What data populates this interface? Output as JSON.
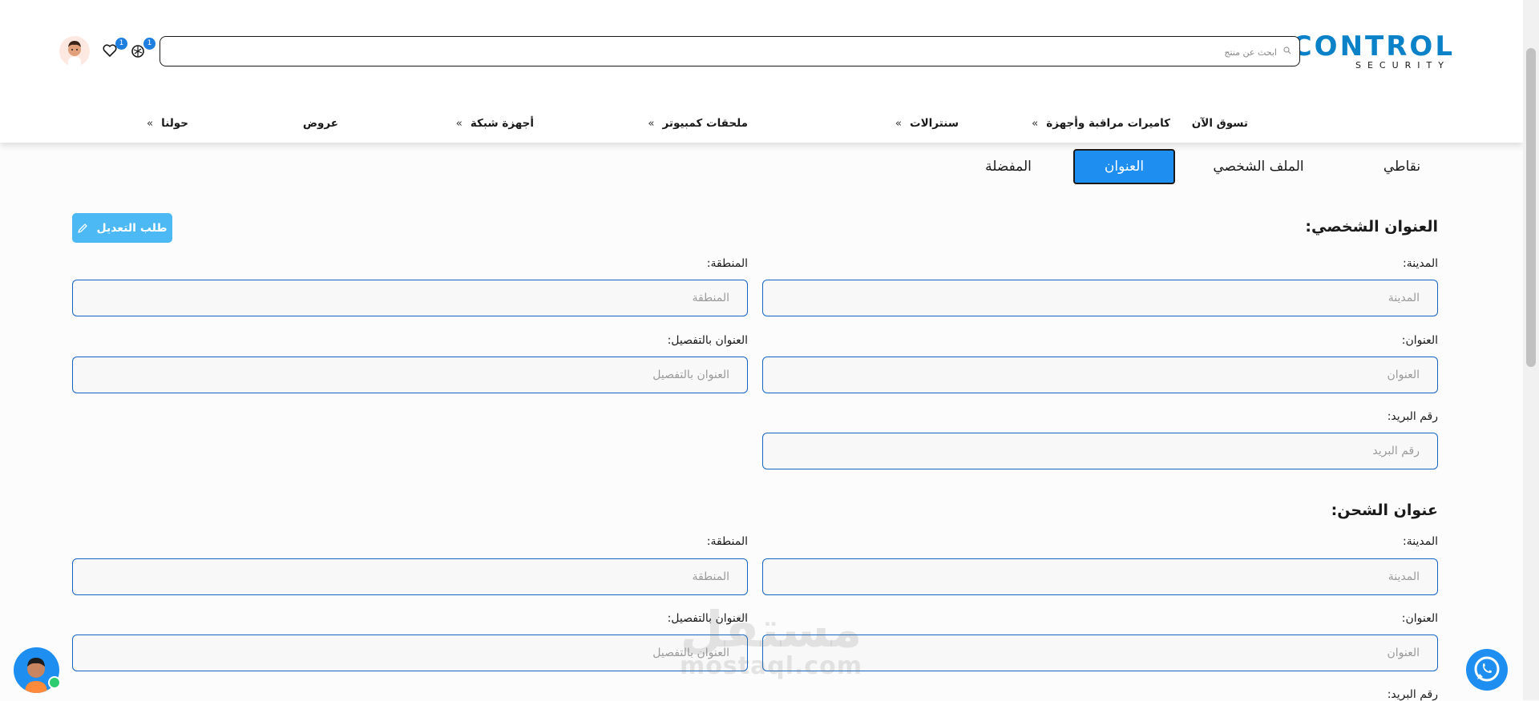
{
  "header": {
    "logo": {
      "main": "CONTROL",
      "sub": "SECURITY"
    },
    "search": {
      "placeholder": "ابحث عن منتج",
      "value": ""
    },
    "cart_count": "1",
    "wishlist_count": "1"
  },
  "nav": {
    "items": [
      {
        "label": "تسوق الآن",
        "chevron": ""
      },
      {
        "label": "كاميرات مراقبة وأجهزة",
        "chevron": "»"
      },
      {
        "label": "سنترالات",
        "chevron": "»"
      },
      {
        "label": "ملحقات كمبيوتر",
        "chevron": "»"
      },
      {
        "label": "أجهزة شبكة",
        "chevron": "»"
      },
      {
        "label": "عروض",
        "chevron": ""
      },
      {
        "label": "حولنا",
        "chevron": "»"
      }
    ]
  },
  "tabs": [
    {
      "label": "نقاطي",
      "active": false
    },
    {
      "label": "الملف الشخصي",
      "active": false
    },
    {
      "label": "العنوان",
      "active": true
    },
    {
      "label": "المفضلة",
      "active": false
    }
  ],
  "personal_address": {
    "title": "العنوان الشخصي:",
    "edit_button": "طلب التعديل",
    "city": {
      "label": "المدينة:",
      "placeholder": "المدينة",
      "value": ""
    },
    "region": {
      "label": "المنطقة:",
      "placeholder": "المنطقة",
      "value": ""
    },
    "address": {
      "label": "العنوان:",
      "placeholder": "العنوان",
      "value": ""
    },
    "detailed_address": {
      "label": "العنوان بالتفصيل:",
      "placeholder": "العنوان بالتفصيل",
      "value": ""
    },
    "postal_code": {
      "label": "رقم البريد:",
      "placeholder": "رقم البريد",
      "value": ""
    }
  },
  "shipping_address": {
    "title": "عنوان الشحن:",
    "city": {
      "label": "المدينة:",
      "placeholder": "المدينة",
      "value": ""
    },
    "region": {
      "label": "المنطقة:",
      "placeholder": "المنطقة",
      "value": ""
    },
    "address": {
      "label": "العنوان:",
      "placeholder": "العنوان",
      "value": ""
    },
    "detailed_address": {
      "label": "العنوان بالتفصيل:",
      "placeholder": "العنوان بالتفصيل",
      "value": ""
    },
    "postal_code": {
      "label": "رقم البريد:"
    }
  },
  "watermark": {
    "arabic": "مستقل",
    "latin": "mostaql.com"
  },
  "colors": {
    "accent": "#1e8ff0",
    "brand": "#0b82c8",
    "input_border": "#1565c0",
    "edit_button": "#4cb8f4"
  },
  "icons": [
    "search-icon",
    "cart-icon",
    "heart-icon",
    "user-avatar",
    "pencil-icon",
    "whatsapp-icon",
    "support-avatar"
  ]
}
